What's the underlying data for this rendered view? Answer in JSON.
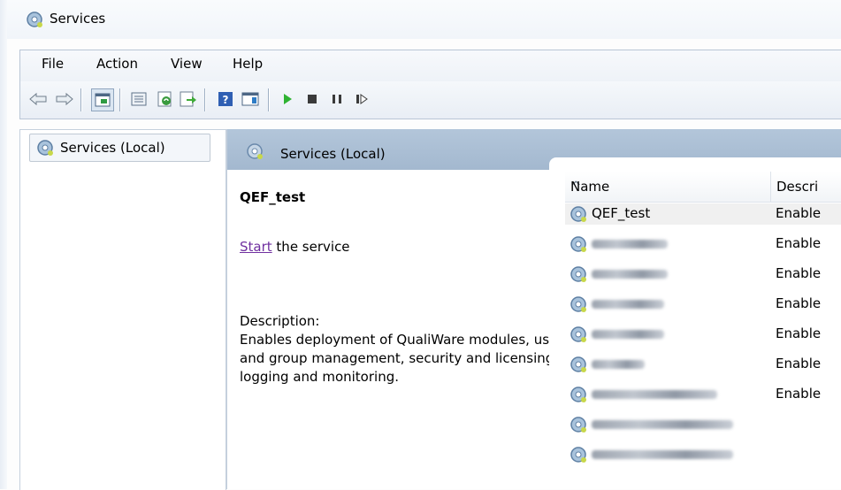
{
  "window": {
    "title": "Services"
  },
  "menu": [
    "File",
    "Action",
    "View",
    "Help"
  ],
  "tree": {
    "item": "Services (Local)"
  },
  "panel": {
    "header": "Services (Local)"
  },
  "detail": {
    "service_name": "QEF_test",
    "start_link": "Start",
    "start_suffix": " the service",
    "description_label": "Description:",
    "description_text": "Enables deployment of QualiWare modules, user and group management, security and licensing, logging and monitoring."
  },
  "list": {
    "columns": {
      "name": "Name",
      "description": "Descri"
    },
    "rows": [
      {
        "name": "QEF_test",
        "desc": "Enable",
        "selected": true
      },
      {
        "name": "",
        "desc": "Enable"
      },
      {
        "name": "",
        "desc": "Enable"
      },
      {
        "name": "",
        "desc": "Enable"
      },
      {
        "name": "",
        "desc": "Enable"
      },
      {
        "name": "",
        "desc": "Enable"
      },
      {
        "name": "",
        "desc": "Enable"
      },
      {
        "name": "",
        "desc": ""
      },
      {
        "name": "",
        "desc": ""
      }
    ]
  },
  "toolbar_icons": [
    "back-icon",
    "forward-icon",
    "show-hide-console-tree-icon",
    "properties-icon",
    "refresh-icon",
    "export-list-icon",
    "help-icon",
    "show-action-pane-icon",
    "start-service-icon",
    "stop-service-icon",
    "pause-service-icon",
    "resume-service-icon"
  ]
}
